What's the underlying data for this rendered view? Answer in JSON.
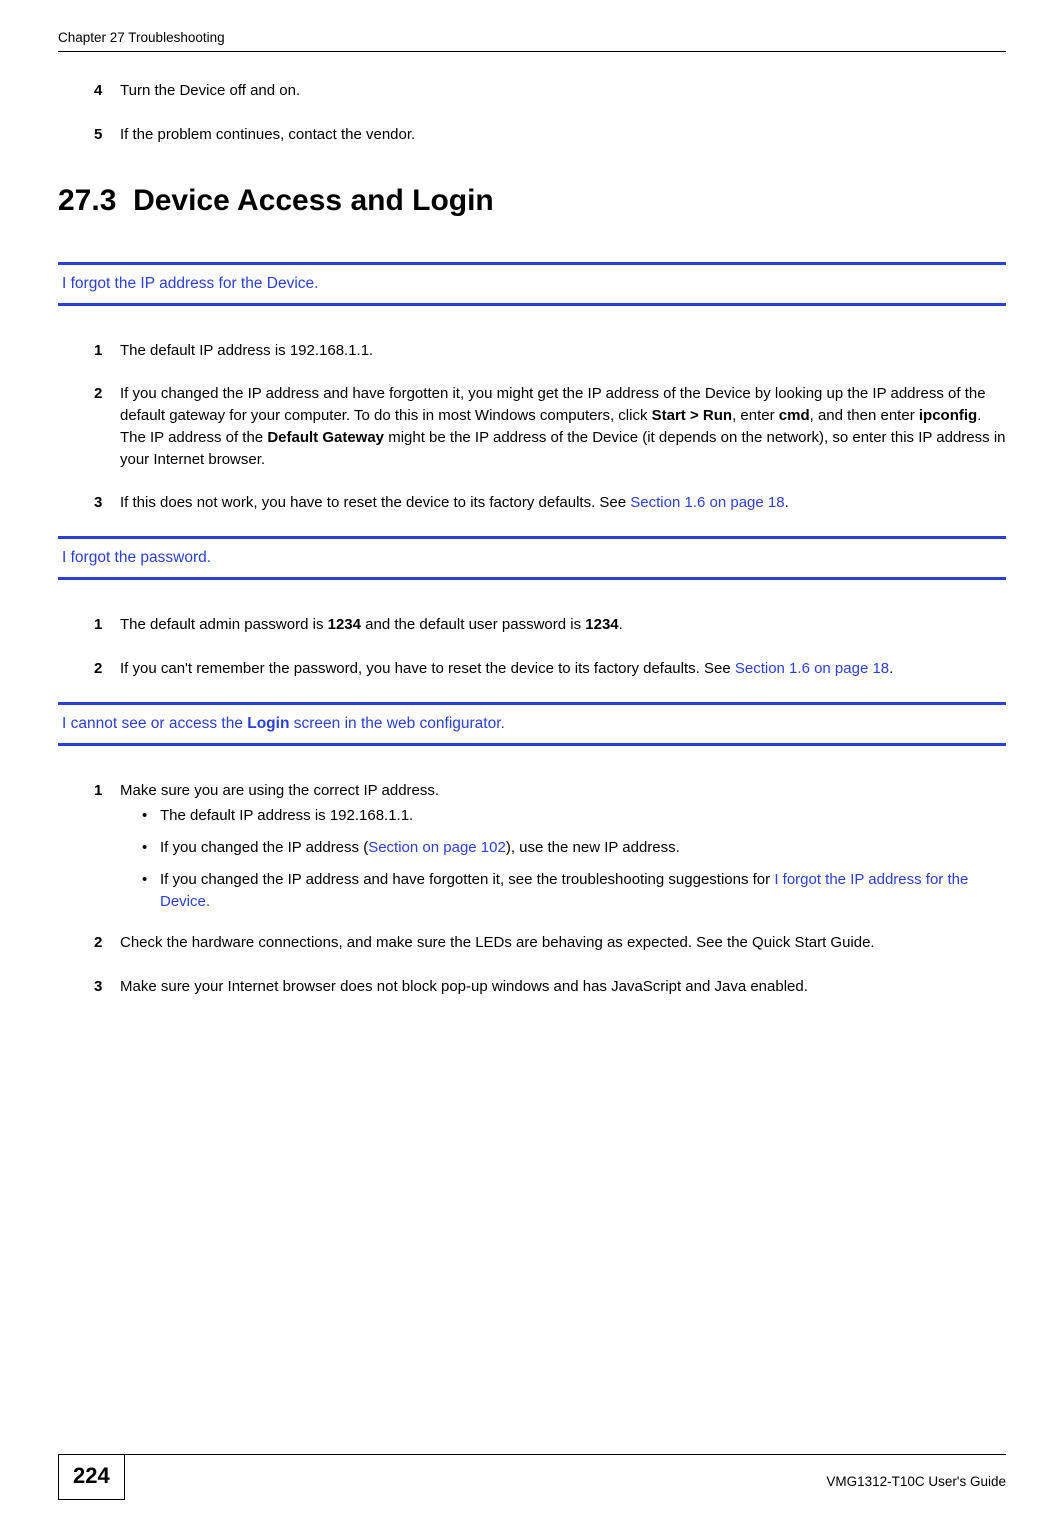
{
  "header": {
    "left": "Chapter 27 Troubleshooting"
  },
  "top_steps": [
    {
      "num": "4",
      "text": "Turn the Device off and on."
    },
    {
      "num": "5",
      "text": "If the problem continues, contact the vendor."
    }
  ],
  "section": {
    "number": "27.3",
    "title": "Device Access and Login"
  },
  "topic1": {
    "title": "I forgot the IP address for the Device.",
    "steps": {
      "s1": {
        "num": "1",
        "text": "The default IP address is 192.168.1.1."
      },
      "s2": {
        "num": "2",
        "pre": "If you changed the IP address and have forgotten it, you might get the IP address of the Device by looking up the IP address of the default gateway for your computer. To do this in most Windows computers, click ",
        "b1": "Start > Run",
        "mid1": ", enter ",
        "b2": "cmd",
        "mid2": ", and then enter ",
        "b3": "ipconfig",
        "mid3": ". The IP address of the ",
        "b4": "Default Gateway",
        "post": " might be the IP address of the Device (it depends on the network), so enter this IP address in your Internet browser."
      },
      "s3": {
        "num": "3",
        "pre": "If this does not work, you have to reset the device to its factory defaults. See ",
        "link": "Section 1.6 on page 18",
        "post": "."
      }
    }
  },
  "topic2": {
    "title": "I forgot the password.",
    "steps": {
      "s1": {
        "num": "1",
        "pre": "The default admin password is ",
        "b1": "1234",
        "mid": " and the default user password is ",
        "b2": "1234",
        "post": "."
      },
      "s2": {
        "num": "2",
        "pre": "If you can't remember the password, you have to reset the device to its factory defaults. See ",
        "link": "Section 1.6 on page 18",
        "post": "."
      }
    }
  },
  "topic3": {
    "title_pre": "I cannot see or access the ",
    "title_bold": "Login",
    "title_post": " screen in the web configurator.",
    "steps": {
      "s1": {
        "num": "1",
        "text": "Make sure you are using the correct IP address.",
        "bullets": {
          "b1": {
            "text": "The default IP address is 192.168.1.1."
          },
          "b2": {
            "pre": "If you changed the IP address (",
            "link": "Section  on page 102",
            "post": "), use the new IP address."
          },
          "b3": {
            "pre": "If you changed the IP address and have forgotten it, see the troubleshooting suggestions for ",
            "link": "I forgot the IP address for the Device."
          }
        }
      },
      "s2": {
        "num": "2",
        "text": "Check the hardware connections, and make sure the LEDs are behaving as expected. See the Quick Start Guide."
      },
      "s3": {
        "num": "3",
        "text": "Make sure your Internet browser does not block pop-up windows and has JavaScript and Java enabled."
      }
    }
  },
  "footer": {
    "page": "224",
    "guide": "VMG1312-T10C User's Guide"
  },
  "glyph": {
    "bullet": "•"
  }
}
